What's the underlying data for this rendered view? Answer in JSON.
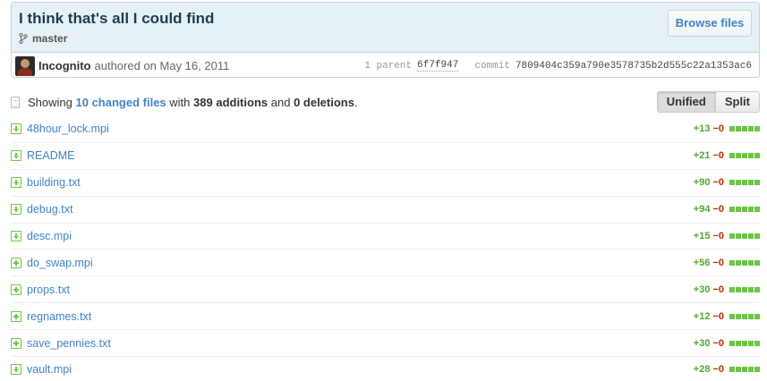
{
  "commit": {
    "title": "I think that's all I could find",
    "branch": "master",
    "browse_label": "Browse files",
    "author": "Incognito",
    "authored_text": "authored on May 16, 2011",
    "parent_label": "1 parent",
    "parent_sha": "6f7f947",
    "commit_label": "commit",
    "commit_sha": "7809404c359a790e3578735b2d555c22a1353ac6"
  },
  "toc": {
    "showing": "Showing",
    "changed": "10 changed files",
    "with": "with",
    "additions": "389 additions",
    "and": "and",
    "deletions": "0 deletions",
    "period": "."
  },
  "view_toggle": {
    "unified": "Unified",
    "split": "Split",
    "selected": "Unified"
  },
  "files": [
    {
      "name": "48hour_lock.mpi",
      "added": "+13",
      "removed": "−0"
    },
    {
      "name": "README",
      "added": "+21",
      "removed": "−0"
    },
    {
      "name": "building.txt",
      "added": "+90",
      "removed": "−0"
    },
    {
      "name": "debug.txt",
      "added": "+94",
      "removed": "−0"
    },
    {
      "name": "desc.mpi",
      "added": "+15",
      "removed": "−0"
    },
    {
      "name": "do_swap.mpi",
      "added": "+56",
      "removed": "−0"
    },
    {
      "name": "props.txt",
      "added": "+30",
      "removed": "−0"
    },
    {
      "name": "regnames.txt",
      "added": "+12",
      "removed": "−0"
    },
    {
      "name": "save_pennies.txt",
      "added": "+30",
      "removed": "−0"
    },
    {
      "name": "vault.mpi",
      "added": "+28",
      "removed": "−0"
    }
  ],
  "colors": {
    "accent": "#4183c4",
    "addition": "#6cc644",
    "deletion": "#bd2c00",
    "header_bg": "#e6f1f6"
  }
}
